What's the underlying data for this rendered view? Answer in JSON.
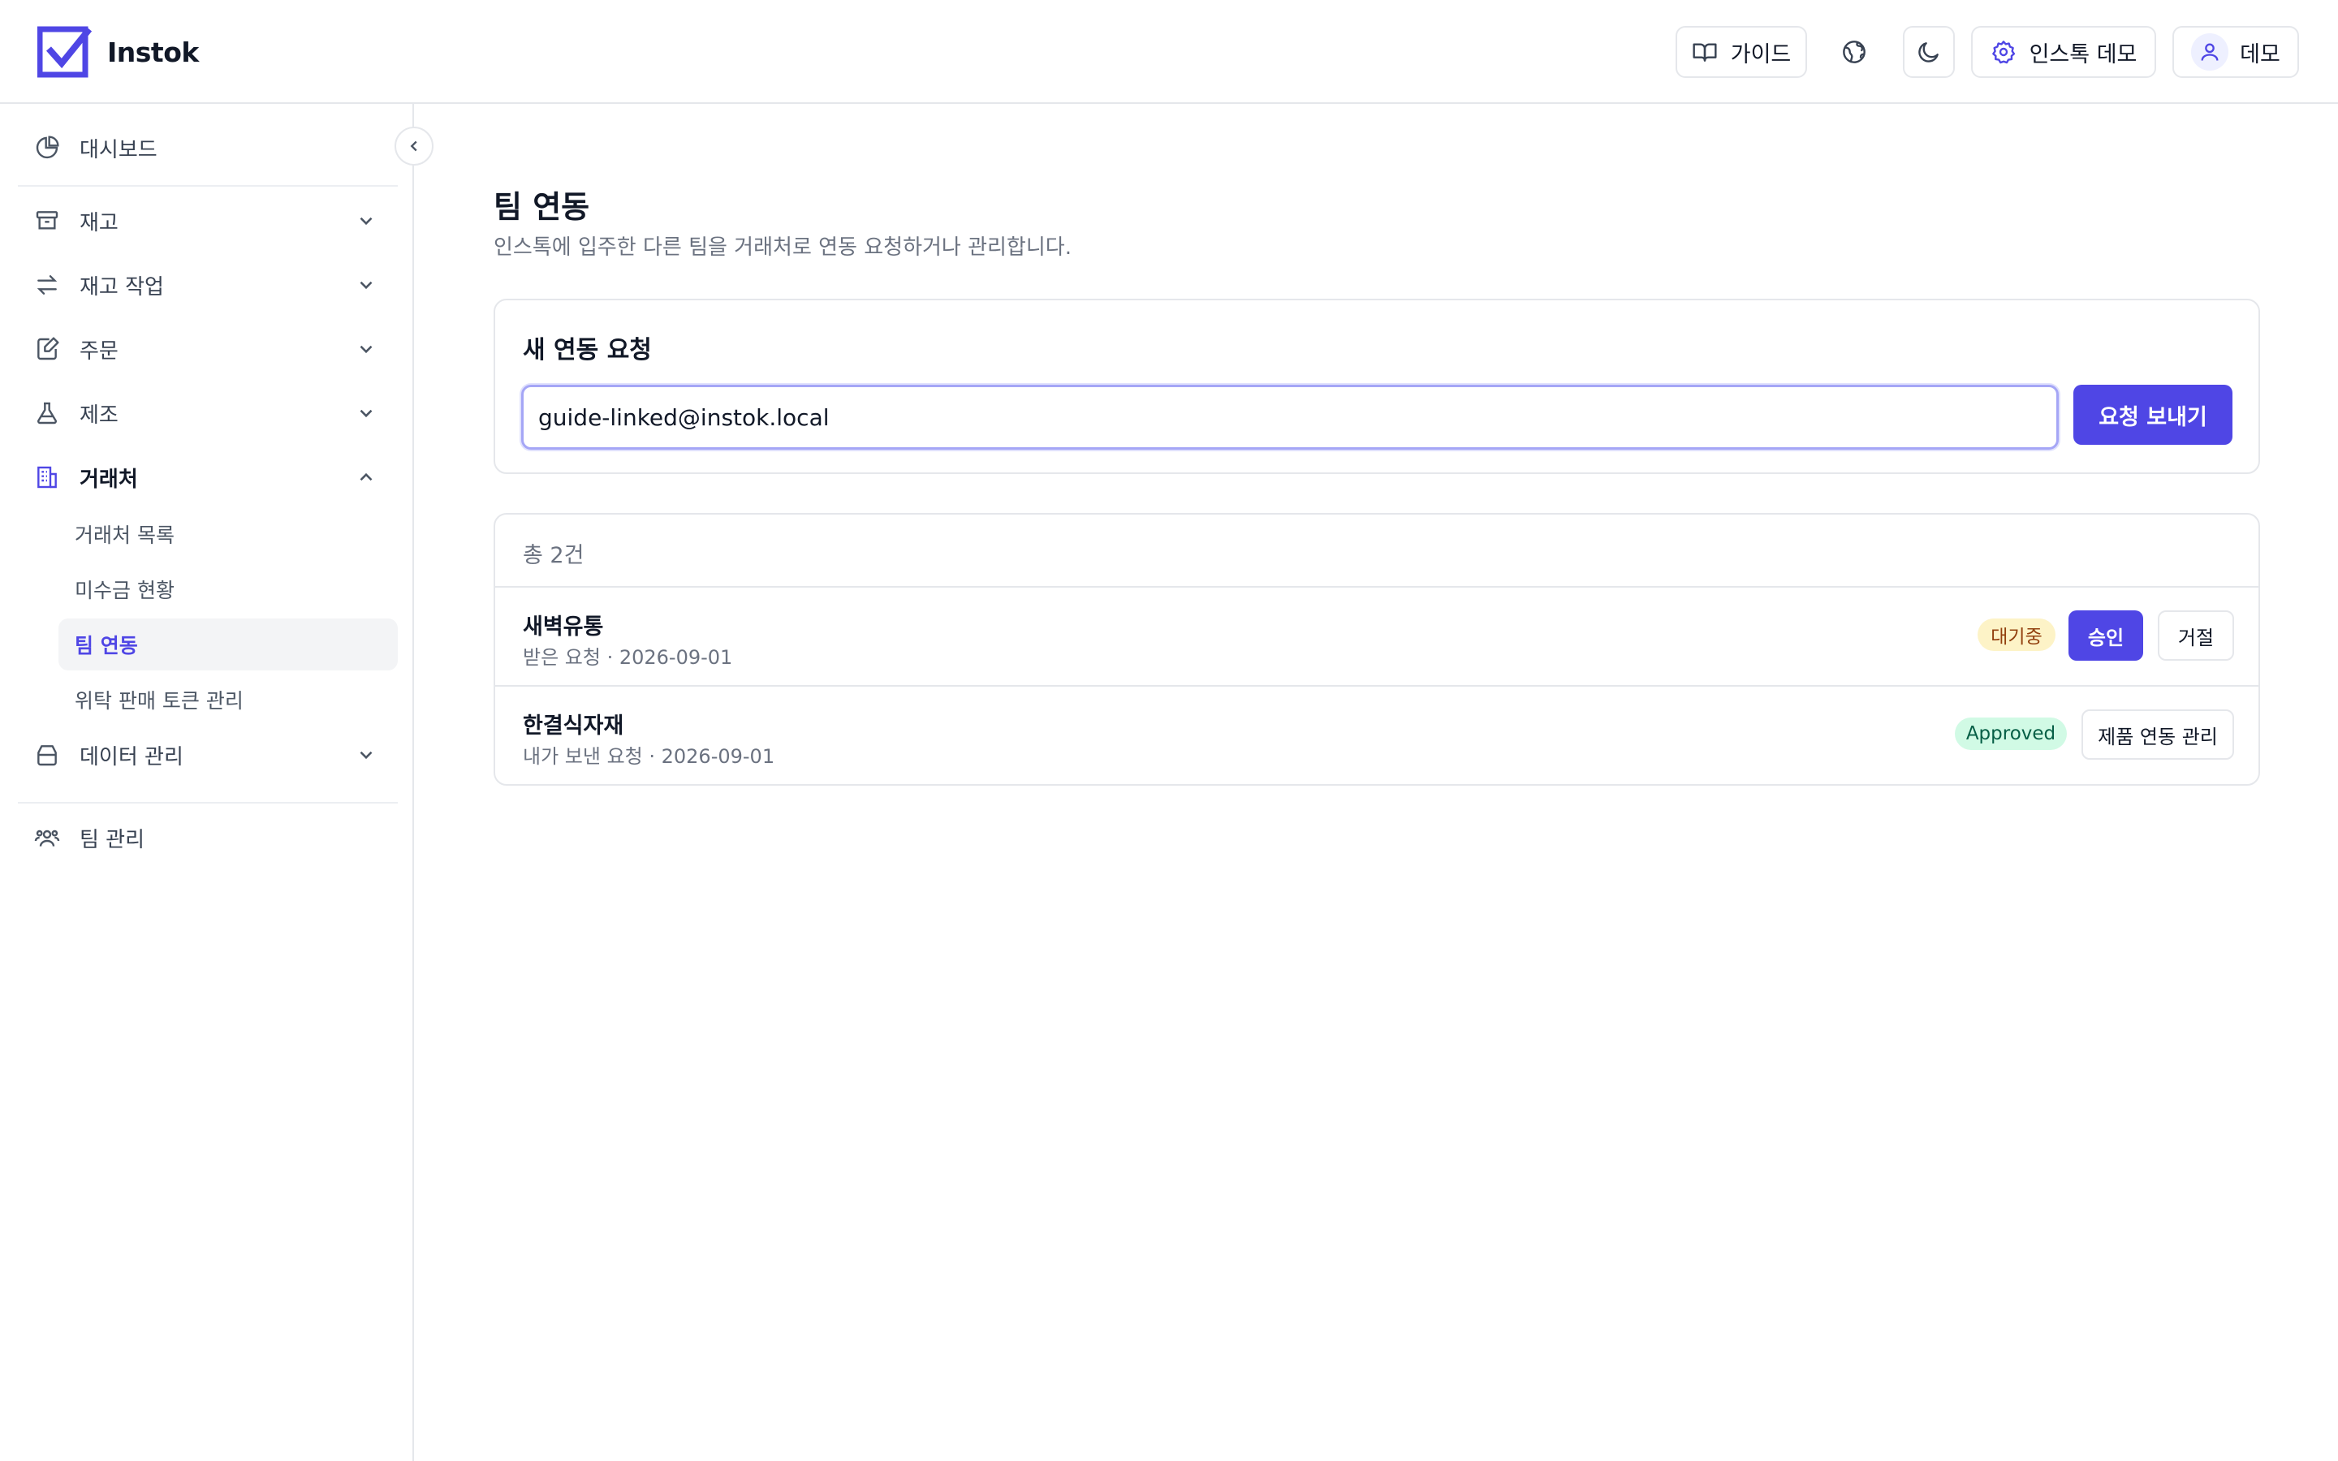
{
  "app": {
    "name": "Instok",
    "brand_color": "#4f46e5"
  },
  "header": {
    "guide_label": "가이드",
    "org_label": "인스톡 데모",
    "user_label": "데모",
    "icons": {
      "guide": "book-open-icon",
      "language": "globe-icon",
      "theme": "moon-icon",
      "org": "gear-icon",
      "user": "user-icon"
    }
  },
  "sidebar": {
    "dashboard": "대시보드",
    "inventory": "재고",
    "inventory_ops": "재고 작업",
    "orders": "주문",
    "manufacturing": "제조",
    "partners": "거래처",
    "partner_sub": {
      "list": "거래처 목록",
      "receivables": "미수금 현황",
      "team_link": "팀 연동",
      "consignment_tokens": "위탁 판매 토큰 관리"
    },
    "data_management": "데이터 관리",
    "team_management": "팀 관리"
  },
  "page": {
    "title": "팀 연동",
    "subtitle": "인스톡에 입주한 다른 팀을 거래처로 연동 요청하거나 관리합니다."
  },
  "new_request": {
    "title": "새 연동 요청",
    "email_value": "guide-linked@instok.local",
    "send_label": "요청 보내기"
  },
  "links": {
    "count_label": "총 2건",
    "rows": [
      {
        "name": "새벽유통",
        "meta": "받은 요청 · 2026-09-01",
        "status": "대기중",
        "status_color": "#fdf3c7",
        "approve_label": "승인",
        "reject_label": "거절"
      },
      {
        "name": "한결식자재",
        "meta": "내가 보낸 요청 · 2026-09-01",
        "status": "Approved",
        "status_color": "#d1fae5",
        "manage_label": "제품 연동 관리"
      }
    ]
  }
}
